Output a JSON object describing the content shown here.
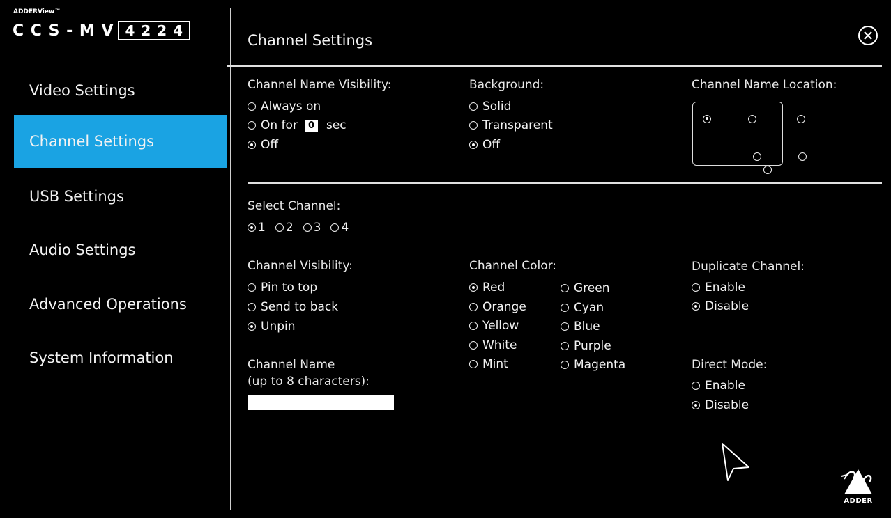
{
  "brand": {
    "small": "ADDERView™",
    "model_prefix": "C C S - M V",
    "model_digits": "4 2 2 4"
  },
  "sidebar": {
    "items": [
      {
        "label": "Video Settings"
      },
      {
        "label": "Channel Settings"
      },
      {
        "label": "USB Settings"
      },
      {
        "label": "Audio Settings"
      },
      {
        "label": "Advanced Operations"
      },
      {
        "label": "System Information"
      }
    ],
    "active_index": 1,
    "active_color": "#1aa3e3"
  },
  "header": {
    "title": "Channel Settings",
    "close_icon": "close-circle-icon"
  },
  "name_visibility": {
    "title": "Channel Name Visibility:",
    "options": [
      {
        "label": "Always on",
        "selected": false
      },
      {
        "label": "On for",
        "selected": false
      },
      {
        "label": "Off",
        "selected": true
      }
    ],
    "seconds_value": "0",
    "seconds_unit": "sec"
  },
  "background": {
    "title": "Background:",
    "options": [
      {
        "label": "Solid",
        "selected": false
      },
      {
        "label": "Transparent",
        "selected": false
      },
      {
        "label": "Off",
        "selected": true
      }
    ]
  },
  "name_location": {
    "title": "Channel Name Location:",
    "selected_index": 0
  },
  "select_channel": {
    "title": "Select Channel:",
    "options": [
      {
        "label": "1",
        "selected": true
      },
      {
        "label": "2",
        "selected": false
      },
      {
        "label": "3",
        "selected": false
      },
      {
        "label": "4",
        "selected": false
      }
    ]
  },
  "channel_visibility": {
    "title": "Channel Visibility:",
    "options": [
      {
        "label": "Pin to top",
        "selected": false
      },
      {
        "label": "Send to back",
        "selected": false
      },
      {
        "label": "Unpin",
        "selected": true
      }
    ]
  },
  "channel_color": {
    "title": "Channel Color:",
    "col1": [
      {
        "label": "Red",
        "selected": true
      },
      {
        "label": "Orange",
        "selected": false
      },
      {
        "label": "Yellow",
        "selected": false
      },
      {
        "label": "White",
        "selected": false
      },
      {
        "label": "Mint",
        "selected": false
      }
    ],
    "col2": [
      {
        "label": "Green",
        "selected": false
      },
      {
        "label": "Cyan",
        "selected": false
      },
      {
        "label": "Blue",
        "selected": false
      },
      {
        "label": "Purple",
        "selected": false
      },
      {
        "label": "Magenta",
        "selected": false
      }
    ]
  },
  "duplicate_channel": {
    "title": "Duplicate Channel:",
    "options": [
      {
        "label": "Enable",
        "selected": false
      },
      {
        "label": "Disable",
        "selected": true
      }
    ]
  },
  "direct_mode": {
    "title": "Direct Mode:",
    "options": [
      {
        "label": "Enable",
        "selected": false
      },
      {
        "label": "Disable",
        "selected": true
      }
    ]
  },
  "channel_name": {
    "title_line1": "Channel Name",
    "title_line2": "(up to 8 characters):",
    "value": ""
  },
  "logo": {
    "text": "ADDER",
    "icon": "adder-dragon-logo-icon"
  }
}
